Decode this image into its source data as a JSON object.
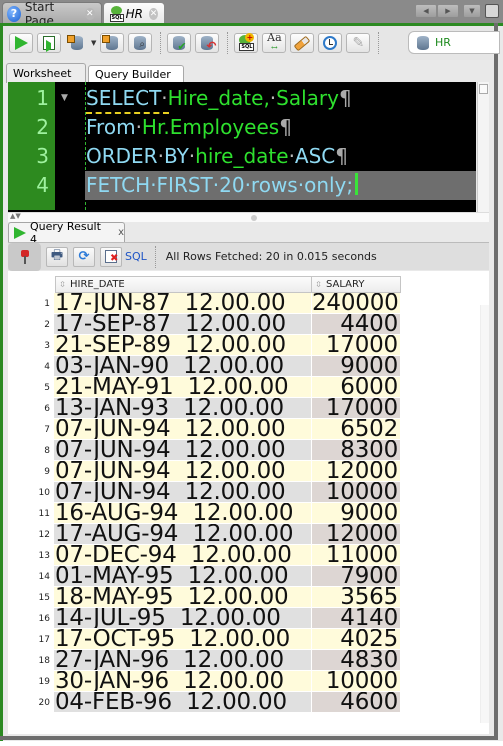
{
  "window": {
    "tabs": [
      {
        "label": "Start Page",
        "icon": "help-icon",
        "active": false
      },
      {
        "label": "HR",
        "icon": "sql-worksheet-icon",
        "active": true
      }
    ],
    "nav_buttons": [
      "◀",
      "▶",
      "▼"
    ]
  },
  "toolbar": {
    "buttons": [
      {
        "name": "run-statement",
        "icon": "play-icon"
      },
      {
        "name": "run-script",
        "icon": "script-icon"
      },
      {
        "name": "explain-plan",
        "icon": "explain-plan-icon"
      },
      {
        "name": "autotrace",
        "icon": "autotrace-icon"
      },
      {
        "name": "sql-tuning-advisor",
        "icon": "tuning-advisor-icon"
      },
      {
        "name": "commit",
        "icon": "commit-icon"
      },
      {
        "name": "rollback",
        "icon": "rollback-icon"
      },
      {
        "name": "unshared-sql-worksheet",
        "icon": "new-sql-worksheet-icon"
      },
      {
        "name": "to-upper-lower",
        "icon": "change-case-icon"
      },
      {
        "name": "clear",
        "icon": "eraser-icon"
      },
      {
        "name": "sql-history",
        "icon": "history-icon"
      },
      {
        "name": "query-builder-tool",
        "icon": "wrench-icon"
      }
    ],
    "dropdown_arrow": "▼",
    "connection": {
      "label": "HR",
      "icon": "database-connection-icon"
    },
    "sql_badge": "SQL",
    "case_glyph": "Aa",
    "case_arrows": "↔"
  },
  "editor_tabs": [
    {
      "label": "Worksheet",
      "active": true
    },
    {
      "label": "Query Builder",
      "active": false
    }
  ],
  "editor": {
    "line_numbers": [
      "1",
      "2",
      "3",
      "4"
    ],
    "lines": [
      {
        "keyword": "SELECT",
        "sep": "·",
        "ident": "Hire_date,",
        "sep2": "·",
        "ident2": "Salary",
        "eol": "¶"
      },
      {
        "keyword": "From",
        "sep": "·",
        "ident": "Hr.Employees",
        "eol": "¶"
      },
      {
        "keyword": "ORDER",
        "sep": "·",
        "keyword2": "BY",
        "sep2": "·",
        "ident": "hire_date",
        "sep3": "·",
        "keyword3": "ASC",
        "eol": "¶"
      },
      {
        "text": "FETCH·FIRST·20·rows·only;"
      }
    ],
    "fold_glyph": "▼",
    "splitter_arrows": "▲▼"
  },
  "results": {
    "tab_label": "Query Result 4",
    "tab_close": "x",
    "sql_link": "SQL",
    "status": "All Rows Fetched: 20 in 0.015 seconds",
    "columns": [
      "HIRE_DATE",
      "SALARY"
    ],
    "sort_glyph": "⇳",
    "rows": [
      {
        "n": "1",
        "hire_date": "17-JUN-87  12.00.00",
        "salary": "240000"
      },
      {
        "n": "2",
        "hire_date": "17-SEP-87  12.00.00",
        "salary": "4400"
      },
      {
        "n": "3",
        "hire_date": "21-SEP-89  12.00.00",
        "salary": "17000"
      },
      {
        "n": "4",
        "hire_date": "03-JAN-90  12.00.00",
        "salary": "9000"
      },
      {
        "n": "5",
        "hire_date": "21-MAY-91  12.00.00",
        "salary": "6000"
      },
      {
        "n": "6",
        "hire_date": "13-JAN-93  12.00.00",
        "salary": "17000"
      },
      {
        "n": "7",
        "hire_date": "07-JUN-94  12.00.00",
        "salary": "6502"
      },
      {
        "n": "8",
        "hire_date": "07-JUN-94  12.00.00",
        "salary": "8300"
      },
      {
        "n": "9",
        "hire_date": "07-JUN-94  12.00.00",
        "salary": "12000"
      },
      {
        "n": "10",
        "hire_date": "07-JUN-94  12.00.00",
        "salary": "10000"
      },
      {
        "n": "11",
        "hire_date": "16-AUG-94  12.00.00",
        "salary": "9000"
      },
      {
        "n": "12",
        "hire_date": "17-AUG-94  12.00.00",
        "salary": "12000"
      },
      {
        "n": "13",
        "hire_date": "07-DEC-94  12.00.00",
        "salary": "11000"
      },
      {
        "n": "14",
        "hire_date": "01-MAY-95  12.00.00",
        "salary": "7900"
      },
      {
        "n": "15",
        "hire_date": "18-MAY-95  12.00.00",
        "salary": "3565"
      },
      {
        "n": "16",
        "hire_date": "14-JUL-95  12.00.00",
        "salary": "4140"
      },
      {
        "n": "17",
        "hire_date": "17-OCT-95  12.00.00",
        "salary": "4025"
      },
      {
        "n": "18",
        "hire_date": "27-JAN-96  12.00.00",
        "salary": "4830"
      },
      {
        "n": "19",
        "hire_date": "30-JAN-96  12.00.00",
        "salary": "10000"
      },
      {
        "n": "20",
        "hire_date": "04-FEB-96  12.00.00",
        "salary": "4600"
      }
    ]
  },
  "colors": {
    "frame_accent": "#2c8a22",
    "keyword": "#8fd9f2",
    "identifier": "#2ee02e",
    "editor_bg": "#000000",
    "row_odd": "#fffbdb",
    "row_even": "#e0e0e0"
  }
}
